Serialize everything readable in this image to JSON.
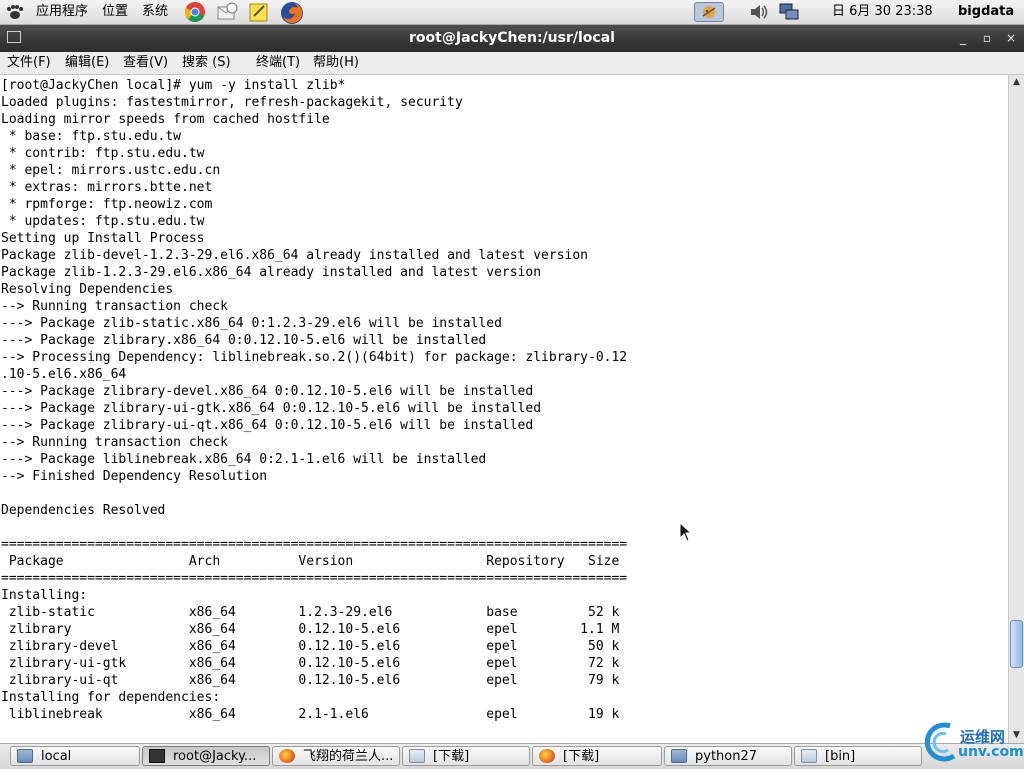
{
  "top_panel": {
    "menus": [
      "应用程序",
      "位置",
      "系统"
    ],
    "launchers": [
      "chrome-icon",
      "mail-icon",
      "notes-icon",
      "firefox-icon"
    ],
    "datetime": "日 6月 30 23:38",
    "user": "bigdata"
  },
  "window": {
    "title": "root@JackyChen:/usr/local"
  },
  "menubar": {
    "items": [
      "文件(F)",
      "编辑(E)",
      "查看(V)",
      "搜索 (S)",
      "终端(T)",
      "帮助(H)"
    ]
  },
  "terminal": {
    "lines": [
      "[root@JackyChen local]# yum -y install zlib*",
      "Loaded plugins: fastestmirror, refresh-packagekit, security",
      "Loading mirror speeds from cached hostfile",
      " * base: ftp.stu.edu.tw",
      " * contrib: ftp.stu.edu.tw",
      " * epel: mirrors.ustc.edu.cn",
      " * extras: mirrors.btte.net",
      " * rpmforge: ftp.neowiz.com",
      " * updates: ftp.stu.edu.tw",
      "Setting up Install Process",
      "Package zlib-devel-1.2.3-29.el6.x86_64 already installed and latest version",
      "Package zlib-1.2.3-29.el6.x86_64 already installed and latest version",
      "Resolving Dependencies",
      "--> Running transaction check",
      "---> Package zlib-static.x86_64 0:1.2.3-29.el6 will be installed",
      "---> Package zlibrary.x86_64 0:0.12.10-5.el6 will be installed",
      "--> Processing Dependency: liblinebreak.so.2()(64bit) for package: zlibrary-0.12",
      ".10-5.el6.x86_64",
      "---> Package zlibrary-devel.x86_64 0:0.12.10-5.el6 will be installed",
      "---> Package zlibrary-ui-gtk.x86_64 0:0.12.10-5.el6 will be installed",
      "---> Package zlibrary-ui-qt.x86_64 0:0.12.10-5.el6 will be installed",
      "--> Running transaction check",
      "---> Package liblinebreak.x86_64 0:2.1-1.el6 will be installed",
      "--> Finished Dependency Resolution",
      "",
      "Dependencies Resolved",
      "",
      "================================================================================",
      " Package                Arch          Version                 Repository   Size",
      "================================================================================",
      "Installing:",
      " zlib-static            x86_64        1.2.3-29.el6            base         52 k",
      " zlibrary               x86_64        0.12.10-5.el6           epel        1.1 M",
      " zlibrary-devel         x86_64        0.12.10-5.el6           epel         50 k",
      " zlibrary-ui-gtk        x86_64        0.12.10-5.el6           epel         72 k",
      " zlibrary-ui-qt         x86_64        0.12.10-5.el6           epel         79 k",
      "Installing for dependencies:",
      " liblinebreak           x86_64        2.1-1.el6               epel         19 k"
    ]
  },
  "taskbar": {
    "tasks": [
      {
        "label": "local",
        "icon": "folder-icon"
      },
      {
        "label": "root@Jacky...",
        "icon": "terminal-icon"
      },
      {
        "label": "飞翔的荷兰人...",
        "icon": "firefox-icon"
      },
      {
        "label": "[下载]",
        "icon": "folder-icon"
      },
      {
        "label": "[下载]",
        "icon": "firefox-icon"
      },
      {
        "label": "python27",
        "icon": "folder-icon"
      },
      {
        "label": "[bin]",
        "icon": "folder-icon"
      }
    ],
    "watermark_text": "运维网",
    "watermark_url": "unv.com"
  },
  "colors": {
    "titlebar": "#3a3a3a",
    "scroll_thumb": "#9ab9e1",
    "terminal_bg": "#ffffff",
    "terminal_fg": "#000000"
  }
}
